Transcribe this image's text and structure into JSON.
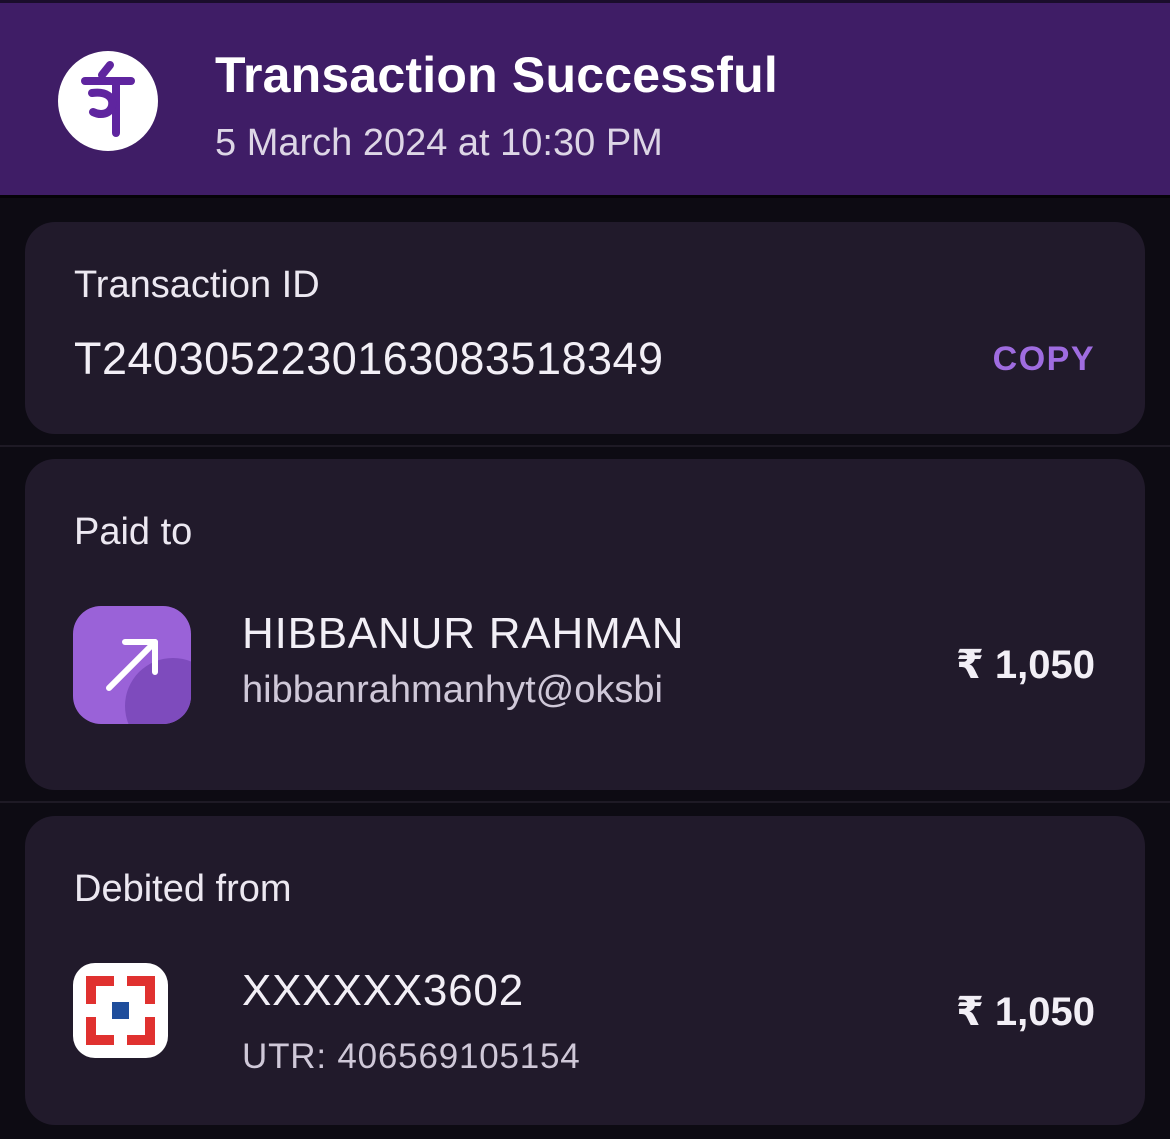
{
  "header": {
    "title": "Transaction Successful",
    "datetime": "5 March 2024 at 10:30 PM",
    "logo_icon": "phonepe-logo",
    "colors": {
      "background": "#3f1d66",
      "accent": "#9f6ce0"
    }
  },
  "transaction": {
    "label": "Transaction ID",
    "id": "T2403052230163083518349",
    "copy_label": "COPY"
  },
  "paid_to": {
    "label": "Paid to",
    "icon": "arrow-up-right-icon",
    "name": "HIBBANUR RAHMAN",
    "upi_id": "hibbanrahmanhyt@oksbi",
    "amount": "₹ 1,050"
  },
  "debited_from": {
    "label": "Debited from",
    "icon": "bank-logo-icon",
    "account": "XXXXXX3602",
    "utr": "UTR: 406569105154",
    "amount": "₹ 1,050"
  }
}
